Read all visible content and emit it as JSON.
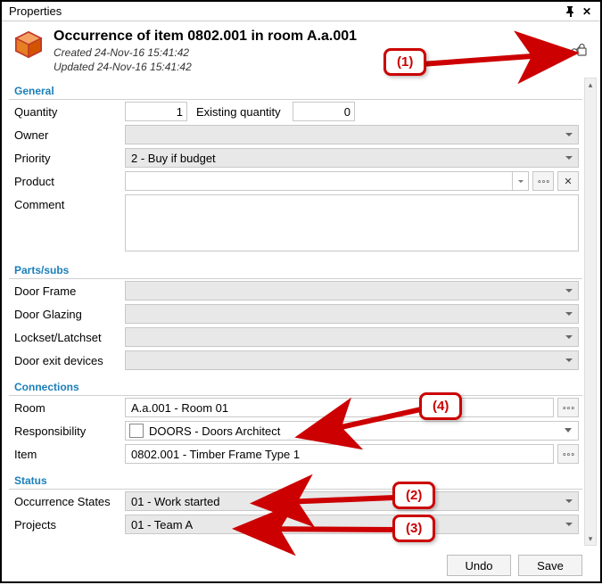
{
  "panel_title": "Properties",
  "header": {
    "title": "Occurrence of item 0802.001 in room A.a.001",
    "created": "Created 24-Nov-16 15:41:42",
    "updated": "Updated 24-Nov-16 15:41:42"
  },
  "sections": {
    "general": "General",
    "parts": "Parts/subs",
    "connections": "Connections",
    "status": "Status"
  },
  "labels": {
    "quantity": "Quantity",
    "existing_quantity": "Existing quantity",
    "owner": "Owner",
    "priority": "Priority",
    "product": "Product",
    "comment": "Comment",
    "door_frame": "Door Frame",
    "door_glazing": "Door Glazing",
    "lockset": "Lockset/Latchset",
    "door_exit": "Door exit devices",
    "room": "Room",
    "responsibility": "Responsibility",
    "item": "Item",
    "occurrence_states": "Occurrence States",
    "projects": "Projects"
  },
  "values": {
    "quantity": "1",
    "existing_quantity": "0",
    "owner": "",
    "priority": "2  - Buy if budget",
    "product": "",
    "comment": "",
    "door_frame": "",
    "door_glazing": "",
    "lockset": "",
    "door_exit": "",
    "room": "A.a.001 - Room 01",
    "responsibility": "DOORS - Doors Architect",
    "item": "0802.001 - Timber Frame Type 1",
    "occurrence_states": "01 - Work started",
    "projects": "01 - Team A"
  },
  "buttons": {
    "undo": "Undo",
    "save": "Save"
  },
  "callouts": {
    "c1": "(1)",
    "c2": "(2)",
    "c3": "(3)",
    "c4": "(4)"
  }
}
